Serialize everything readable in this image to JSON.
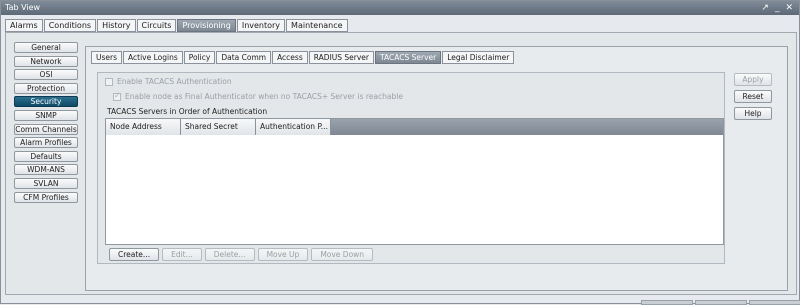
{
  "window": {
    "title": "Tab View",
    "controls": [
      "↗",
      "_",
      "✕"
    ]
  },
  "top_tabs": [
    {
      "label": "Alarms",
      "active": false
    },
    {
      "label": "Conditions",
      "active": false
    },
    {
      "label": "History",
      "active": false
    },
    {
      "label": "Circuits",
      "active": false
    },
    {
      "label": "Provisioning",
      "active": true
    },
    {
      "label": "Inventory",
      "active": false
    },
    {
      "label": "Maintenance",
      "active": false
    }
  ],
  "sidebar": {
    "items": [
      {
        "label": "General",
        "active": false
      },
      {
        "label": "Network",
        "active": false
      },
      {
        "label": "OSI",
        "active": false
      },
      {
        "label": "Protection",
        "active": false
      },
      {
        "label": "Security",
        "active": true
      },
      {
        "label": "SNMP",
        "active": false
      },
      {
        "label": "Comm Channels",
        "active": false
      },
      {
        "label": "Alarm Profiles",
        "active": false
      },
      {
        "label": "Defaults",
        "active": false
      },
      {
        "label": "WDM-ANS",
        "active": false
      },
      {
        "label": "SVLAN",
        "active": false
      },
      {
        "label": "CFM Profiles",
        "active": false
      }
    ]
  },
  "sub_tabs": [
    {
      "label": "Users",
      "active": false
    },
    {
      "label": "Active Logins",
      "active": false
    },
    {
      "label": "Policy",
      "active": false
    },
    {
      "label": "Data Comm",
      "active": false
    },
    {
      "label": "Access",
      "active": false
    },
    {
      "label": "RADIUS Server",
      "active": false
    },
    {
      "label": "TACACS Server",
      "active": true
    },
    {
      "label": "Legal Disclaimer",
      "active": false
    }
  ],
  "tacacs": {
    "enable_label": "Enable TACACS Authentication",
    "enable_checked": false,
    "final_auth_label": "Enable node as Final Authenticator when no TACACS+ Server is reachable",
    "final_auth_checked": true,
    "section_label": "TACACS Servers in Order of Authentication",
    "columns": [
      "Node Address",
      "Shared Secret",
      "Authentication P..."
    ],
    "rows": []
  },
  "actions": [
    {
      "label": "Create...",
      "enabled": true
    },
    {
      "label": "Edit...",
      "enabled": false
    },
    {
      "label": "Delete...",
      "enabled": false
    },
    {
      "label": "Move Up",
      "enabled": false
    },
    {
      "label": "Move Down",
      "enabled": false
    }
  ],
  "right_buttons": [
    {
      "label": "Apply",
      "enabled": false
    },
    {
      "label": "Reset",
      "enabled": true
    },
    {
      "label": "Help",
      "enabled": true
    }
  ]
}
